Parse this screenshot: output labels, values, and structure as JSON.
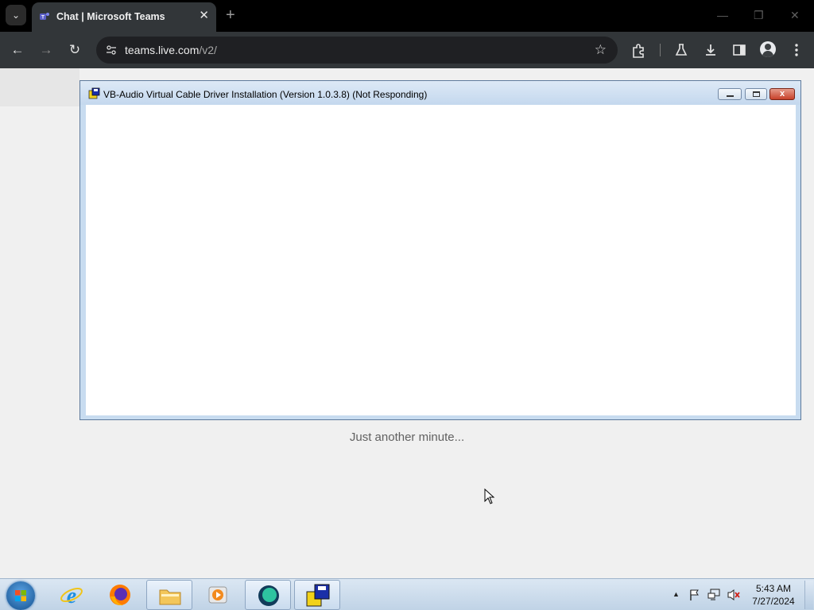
{
  "browser": {
    "tab": {
      "title": "Chat | Microsoft Teams",
      "close_glyph": "✕"
    },
    "tab_list_glyph": "⌄",
    "new_tab_glyph": "+",
    "window_controls": {
      "minimize": "—",
      "restore": "❐",
      "close": "✕"
    },
    "nav": {
      "back": "←",
      "forward": "→",
      "reload": "↻"
    },
    "url": {
      "host": "teams.live.com",
      "path": "/v2/"
    },
    "bookmark_glyph": "☆",
    "toolbar_icons": [
      "extensions-icon",
      "labs-icon",
      "download-icon",
      "side-panel-icon",
      "profile-icon",
      "menu-icon"
    ]
  },
  "page": {
    "status_message": "Just another minute..."
  },
  "installer_window": {
    "title": "VB-Audio Virtual Cable Driver Installation (Version 1.0.3.8) (Not Responding)",
    "close_glyph": "x"
  },
  "taskbar": {
    "apps": [
      "internet-explorer",
      "firefox",
      "file-explorer",
      "media-player",
      "teams-installer",
      "vb-audio-setup"
    ],
    "time": "5:43 AM",
    "date": "7/27/2024",
    "tray_arrow": "▲"
  },
  "colors": {
    "browser_frame": "#000000",
    "toolbar": "#323639",
    "page_bg": "#f0f0f0",
    "window_frame": "#c8dcf0",
    "close_red": "#c7402a"
  }
}
